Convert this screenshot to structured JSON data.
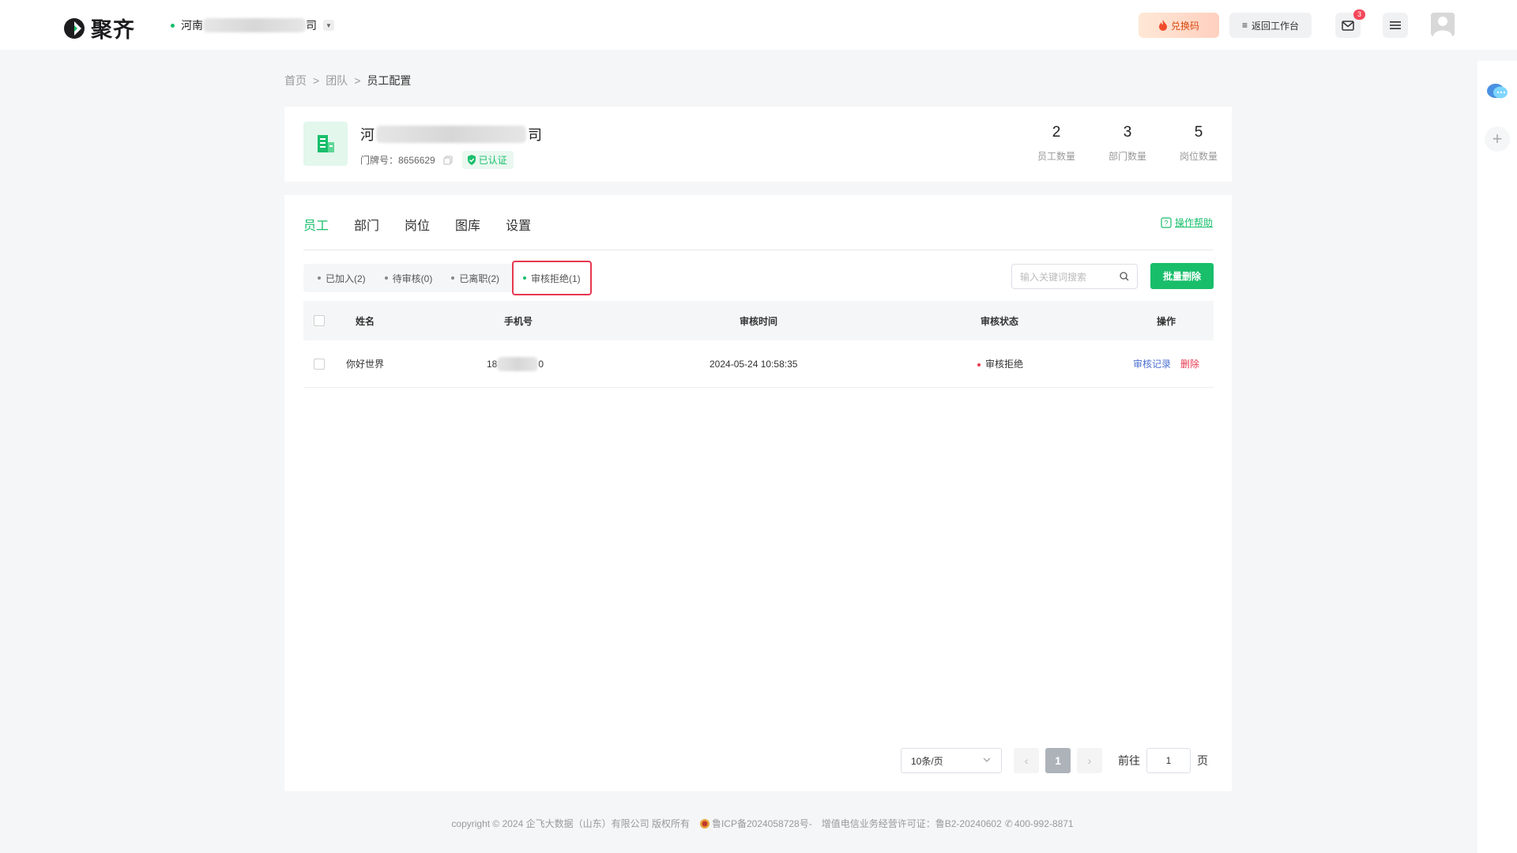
{
  "header": {
    "logo_text": "聚齐",
    "company_prefix": "河南",
    "company_suffix": "司",
    "redeem_label": "兑换码",
    "back_label": "返回工作台",
    "mail_badge": "3"
  },
  "breadcrumb": {
    "home": "首页",
    "team": "团队",
    "current": "员工配置",
    "sep": ">"
  },
  "company": {
    "name_prefix": "河",
    "name_suffix": "司",
    "house_no_label": "门牌号：8656629",
    "verified_label": "已认证",
    "stats": [
      {
        "value": "2",
        "label": "员工数量"
      },
      {
        "value": "3",
        "label": "部门数量"
      },
      {
        "value": "5",
        "label": "岗位数量"
      }
    ]
  },
  "tabs": [
    "员工",
    "部门",
    "岗位",
    "图库",
    "设置"
  ],
  "help_label": "操作帮助",
  "filters": [
    "已加入(2)",
    "待审核(0)",
    "已离职(2)",
    "审核拒绝(1)"
  ],
  "search": {
    "placeholder": "输入关键词搜索"
  },
  "batch_delete_label": "批量删除",
  "table": {
    "headers": [
      "姓名",
      "手机号",
      "审核时间",
      "审核状态",
      "操作"
    ],
    "rows": [
      {
        "name": "你好世界",
        "phone_prefix": "18",
        "phone_suffix": "0",
        "time": "2024-05-24 10:58:35",
        "status": "审核拒绝",
        "action_record": "审核记录",
        "action_delete": "删除"
      }
    ]
  },
  "pager": {
    "page_size": "10条/页",
    "current_page": "1",
    "goto_label": "前往",
    "goto_value": "1",
    "page_unit": "页"
  },
  "footer": {
    "copyright": "copyright © 2024 企飞大数据（山东）有限公司 版权所有",
    "icp": "鲁ICP备2024058728号-",
    "license": "增值电信业务经营许可证：鲁B2-20240602",
    "phone": "400-992-8871"
  },
  "colors": {
    "accent": "#19be6b",
    "danger": "#e8384f",
    "link": "#4a6fd1"
  }
}
